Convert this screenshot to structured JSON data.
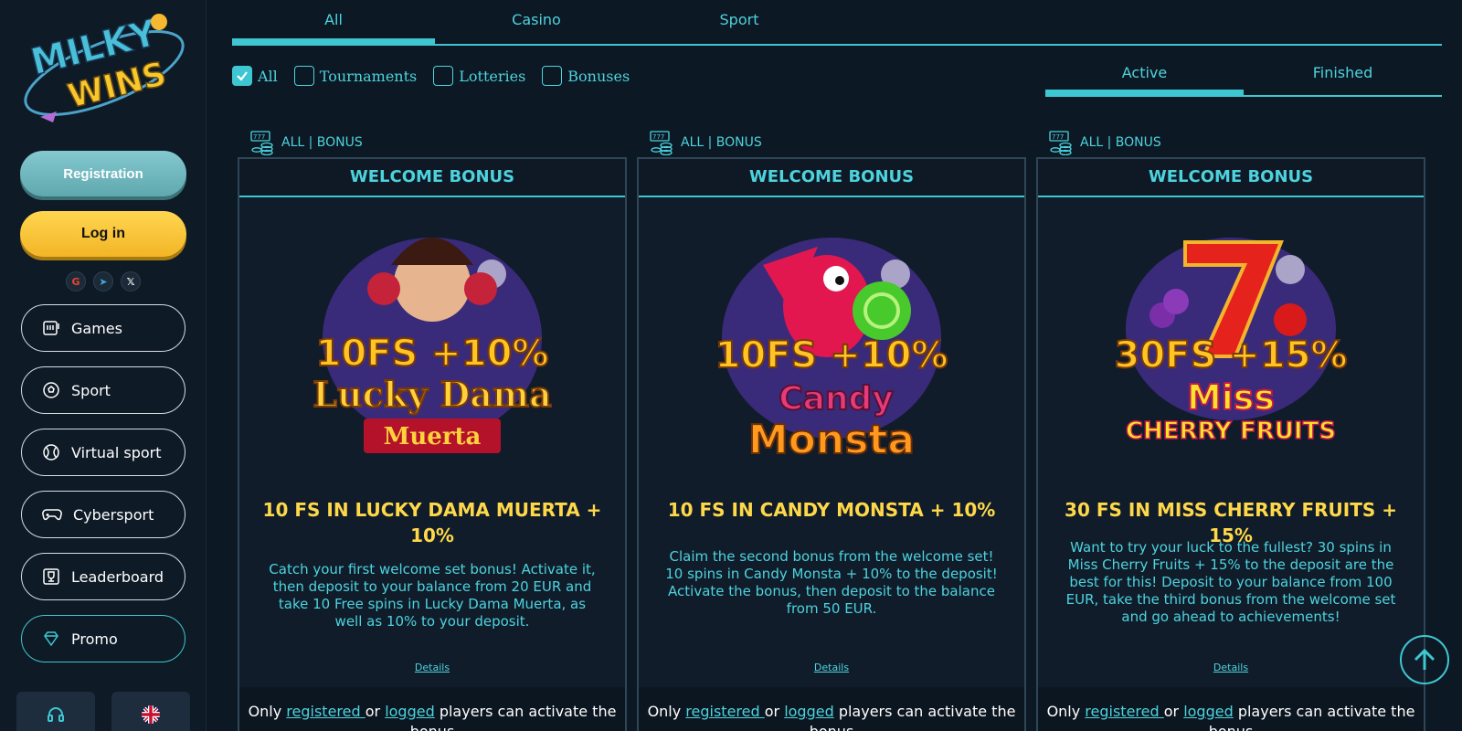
{
  "sidebar": {
    "logo_text_1": "MILKY",
    "logo_text_2": "WINS",
    "registration_label": "Registration",
    "login_label": "Log in",
    "socials": [
      {
        "name": "google-icon",
        "glyph": "G"
      },
      {
        "name": "telegram-icon",
        "glyph": "➤"
      },
      {
        "name": "x-icon",
        "glyph": "𝕏"
      }
    ],
    "nav": [
      {
        "label": "Games",
        "icon": "slot-machine-icon"
      },
      {
        "label": "Sport",
        "icon": "soccer-ball-icon"
      },
      {
        "label": "Virtual sport",
        "icon": "tennis-ball-icon"
      },
      {
        "label": "Cybersport",
        "icon": "gamepad-icon"
      },
      {
        "label": "Leaderboard",
        "icon": "trophy-icon"
      },
      {
        "label": "Promo",
        "icon": "diamond-icon"
      }
    ],
    "bottom": [
      {
        "icon": "headset-icon"
      },
      {
        "icon": "uk-flag-icon"
      }
    ]
  },
  "tabs": [
    {
      "label": "All",
      "active": true
    },
    {
      "label": "Casino",
      "active": false
    },
    {
      "label": "Sport",
      "active": false
    }
  ],
  "filters": [
    {
      "label": "All",
      "checked": true
    },
    {
      "label": "Tournaments",
      "checked": false
    },
    {
      "label": "Lotteries",
      "checked": false
    },
    {
      "label": "Bonuses",
      "checked": false
    }
  ],
  "status_tabs": [
    {
      "label": "Active",
      "active": true
    },
    {
      "label": "Finished",
      "active": false
    }
  ],
  "cards": [
    {
      "category": "ALL | BONUS",
      "header": "WELCOME BONUS",
      "image_text": {
        "offer": "10FS +10%",
        "game1": "Lucky Dama",
        "game2": "Muerta"
      },
      "title": "10 FS IN LUCKY DAMA MUERTA + 10%",
      "description": "Catch your first welcome set bonus! Activate it, then deposit to your balance from 20 EUR and take 10 Free spins in Lucky Dama Muerta, as well as 10% to your deposit.",
      "details": "Details",
      "foot_only": "Only ",
      "foot_registered": "registered ",
      "foot_or": "or ",
      "foot_logged": "logged",
      "foot_rest": " players can activate the bonus"
    },
    {
      "category": "ALL | BONUS",
      "header": "WELCOME BONUS",
      "image_text": {
        "offer": "10FS +10%",
        "game1": "Candy",
        "game2": "Monsta"
      },
      "title": "10 FS IN CANDY MONSTA + 10%",
      "description": "Claim the second bonus from the welcome set! 10 spins in Candy Monsta + 10% to the deposit! Activate the bonus, then deposit to the balance from 50 EUR.",
      "details": "Details",
      "foot_only": "Only ",
      "foot_registered": "registered ",
      "foot_or": "or ",
      "foot_logged": "logged",
      "foot_rest": " players can activate the bonus"
    },
    {
      "category": "ALL | BONUS",
      "header": "WELCOME BONUS",
      "image_text": {
        "offer": "30FS +15%",
        "game1": "Miss",
        "game2": "CHERRY FRUITS"
      },
      "title": "30 FS IN MISS CHERRY FRUITS + 15%",
      "description": "Want to try your luck to the fullest? 30 spins in Miss Cherry Fruits + 15% to the deposit are the best for this! Deposit to your balance from 100 EUR, take the third bonus from the welcome set and go ahead to achievements!",
      "details": "Details",
      "foot_only": "Only ",
      "foot_registered": "registered ",
      "foot_or": "or ",
      "foot_logged": "logged",
      "foot_rest": " players can activate the bonus"
    }
  ],
  "colors": {
    "accent": "#3ec7d2",
    "yellow": "#ffd84a",
    "bg": "#0c1823"
  }
}
